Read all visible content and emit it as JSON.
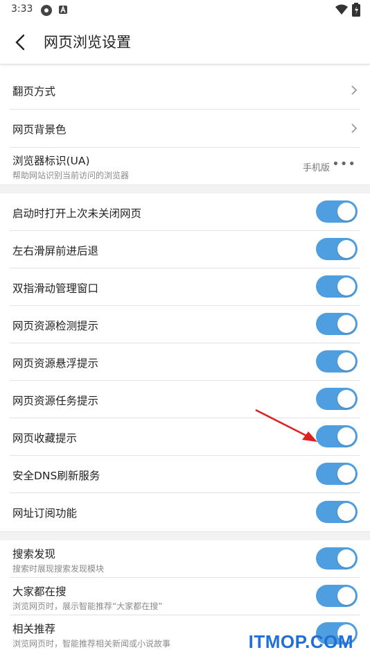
{
  "status_bar": {
    "time": "3:33"
  },
  "header": {
    "title": "网页浏览设置"
  },
  "group1": [
    {
      "label": "翻页方式"
    },
    {
      "label": "网页背景色"
    },
    {
      "label": "浏览器标识(UA)",
      "subtitle": "帮助网站识别当前访问的浏览器",
      "value": "手机版",
      "more": "•••"
    }
  ],
  "group2": [
    {
      "label": "启动时打开上次未关闭网页",
      "enabled": true
    },
    {
      "label": "左右滑屏前进后退",
      "enabled": true
    },
    {
      "label": "双指滑动管理窗口",
      "enabled": true
    },
    {
      "label": "网页资源检测提示",
      "enabled": true
    },
    {
      "label": "网页资源悬浮提示",
      "enabled": true
    },
    {
      "label": "网页资源任务提示",
      "enabled": true
    },
    {
      "label": "网页收藏提示",
      "enabled": true
    },
    {
      "label": "安全DNS刷新服务",
      "enabled": true
    },
    {
      "label": "网址订阅功能",
      "enabled": true
    }
  ],
  "group3": [
    {
      "label": "搜索发现",
      "subtitle": "搜索时展现搜索发现模块",
      "enabled": true
    },
    {
      "label": "大家都在搜",
      "subtitle": "浏览网页时，展示智能推荐“大家都在搜”",
      "enabled": true
    },
    {
      "label": "相关推荐",
      "subtitle": "浏览网页时，智能推荐相关新闻或小说故事",
      "enabled": true
    }
  ],
  "watermark": "ITMOP.COM",
  "colors": {
    "toggle_on": "#4f9fe0",
    "arrow": "#e02020",
    "watermark": "#1f6fd6"
  }
}
